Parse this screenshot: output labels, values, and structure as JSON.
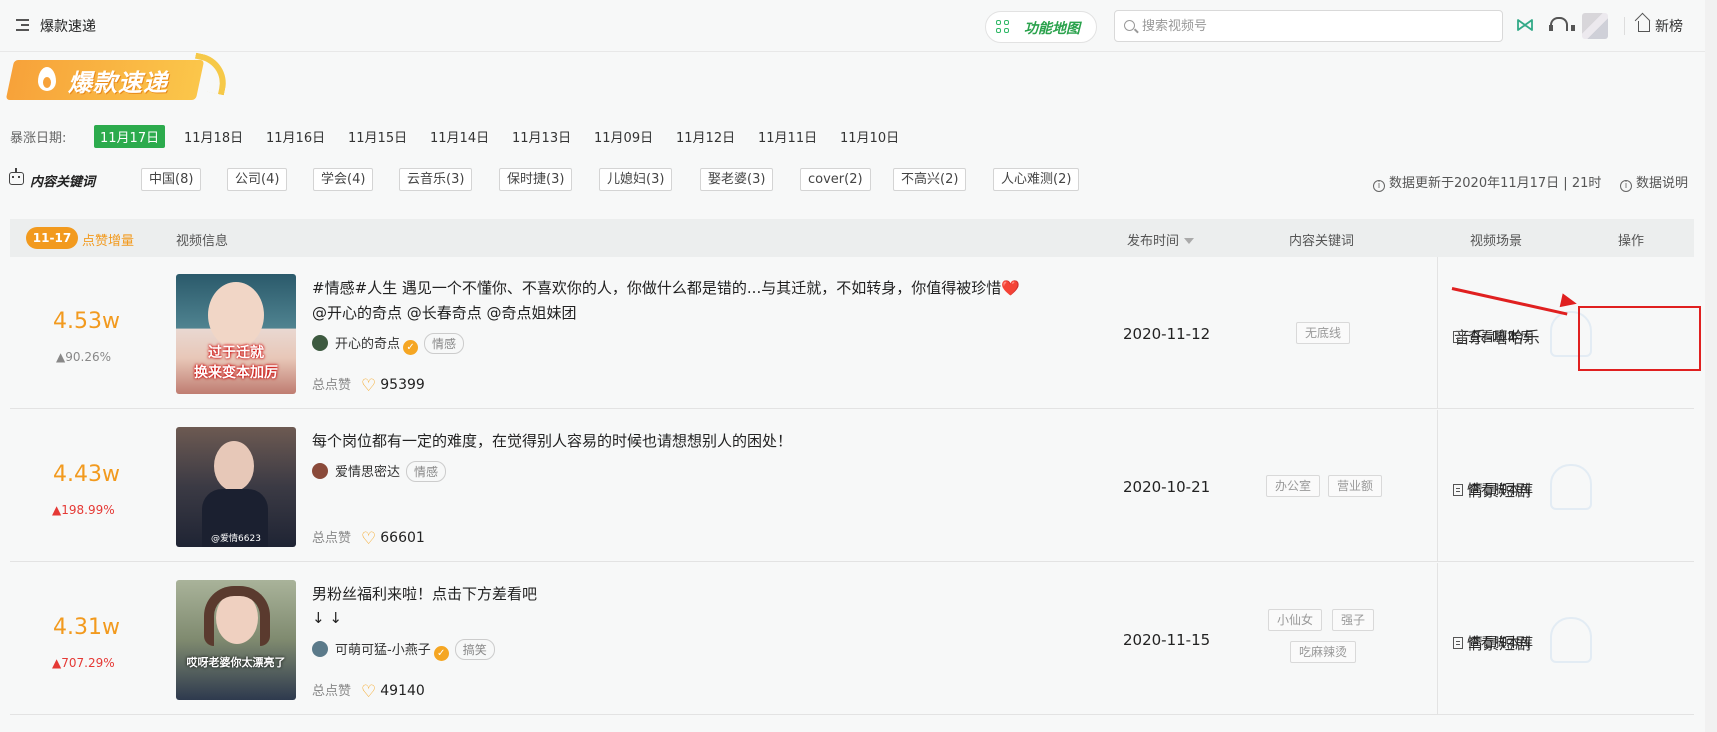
{
  "topbar": {
    "title": "爆款速递",
    "function_map": "功能地图",
    "search_placeholder": "搜索视频号",
    "new_rank": "新榜"
  },
  "banner": {
    "text": "爆款速递"
  },
  "dates": {
    "label": "暴涨日期:",
    "items": [
      "11月17日",
      "11月18日",
      "11月16日",
      "11月15日",
      "11月14日",
      "11月13日",
      "11月09日",
      "11月12日",
      "11月11日",
      "11月10日"
    ],
    "active_index": 0
  },
  "keywords": {
    "label": "内容关键词",
    "items": [
      "中国(8)",
      "公司(4)",
      "学会(4)",
      "云音乐(3)",
      "保时捷(3)",
      "儿媳妇(3)",
      "娶老婆(3)",
      "cover(2)",
      "不高兴(2)",
      "人心难测(2)"
    ],
    "update_info": "数据更新于2020年11月17日 | 21时",
    "data_explain": "数据说明"
  },
  "table": {
    "header": {
      "date_badge": "11-17",
      "likes_increase": "点赞增量",
      "video_info": "视频信息",
      "publish_time": "发布时间",
      "content_keywords": "内容关键词",
      "video_scene": "视频场景",
      "action": "操作"
    },
    "rows": [
      {
        "increase": "4.53w",
        "increase_pct": "▲90.26%",
        "title_line1": "#情感#人生 遇见一个不懂你、不喜欢你的人，你做什么都是错的...与其迁就，不如转身，你值得被珍惜❤️",
        "title_line2": "@开心的奇点 @长春奇点 @奇点姐妹团",
        "thumb_caption": [
          "过于迁就",
          "换来变本加厉"
        ],
        "author": "开心的奇点",
        "verified": true,
        "tag": "情感",
        "likes_label": "总点赞",
        "likes": "95399",
        "publish_date": "2020-11-12",
        "keywords": [
          "无底线"
        ],
        "scene": "音乐-嘻哈乐",
        "action": "查看脚本库"
      },
      {
        "increase": "4.43w",
        "increase_pct": "▲198.99%",
        "title_line1": "每个岗位都有一定的难度，在觉得别人容易的时候也请想想别人的困处！",
        "title_line2": "",
        "thumb_caption": [
          "@爱情6623"
        ],
        "author": "爱情思密达",
        "verified": false,
        "tag": "情感",
        "likes_label": "总点赞",
        "likes": "66601",
        "publish_date": "2020-10-21",
        "keywords": [
          "办公室",
          "营业额"
        ],
        "scene": "情景短剧",
        "action": "查看脚本库"
      },
      {
        "increase": "4.31w",
        "increase_pct": "▲707.29%",
        "title_line1": "男粉丝福利来啦！点击下方差看吧",
        "title_line2": "↓                    ↓",
        "thumb_caption": [
          "哎呀老婆你太漂亮了"
        ],
        "author": "可萌可猛-小燕子",
        "verified": true,
        "tag": "搞笑",
        "likes_label": "总点赞",
        "likes": "49140",
        "publish_date": "2020-11-15",
        "keywords": [
          "小仙女",
          "强子",
          "吃麻辣烫"
        ],
        "scene": "情景短剧",
        "action": "查看脚本库"
      }
    ]
  },
  "colors": {
    "accent_green": "#2cab4d",
    "accent_orange": "#f29a1e",
    "increase_red": "#e53935",
    "annotation_red": "#e02020"
  }
}
